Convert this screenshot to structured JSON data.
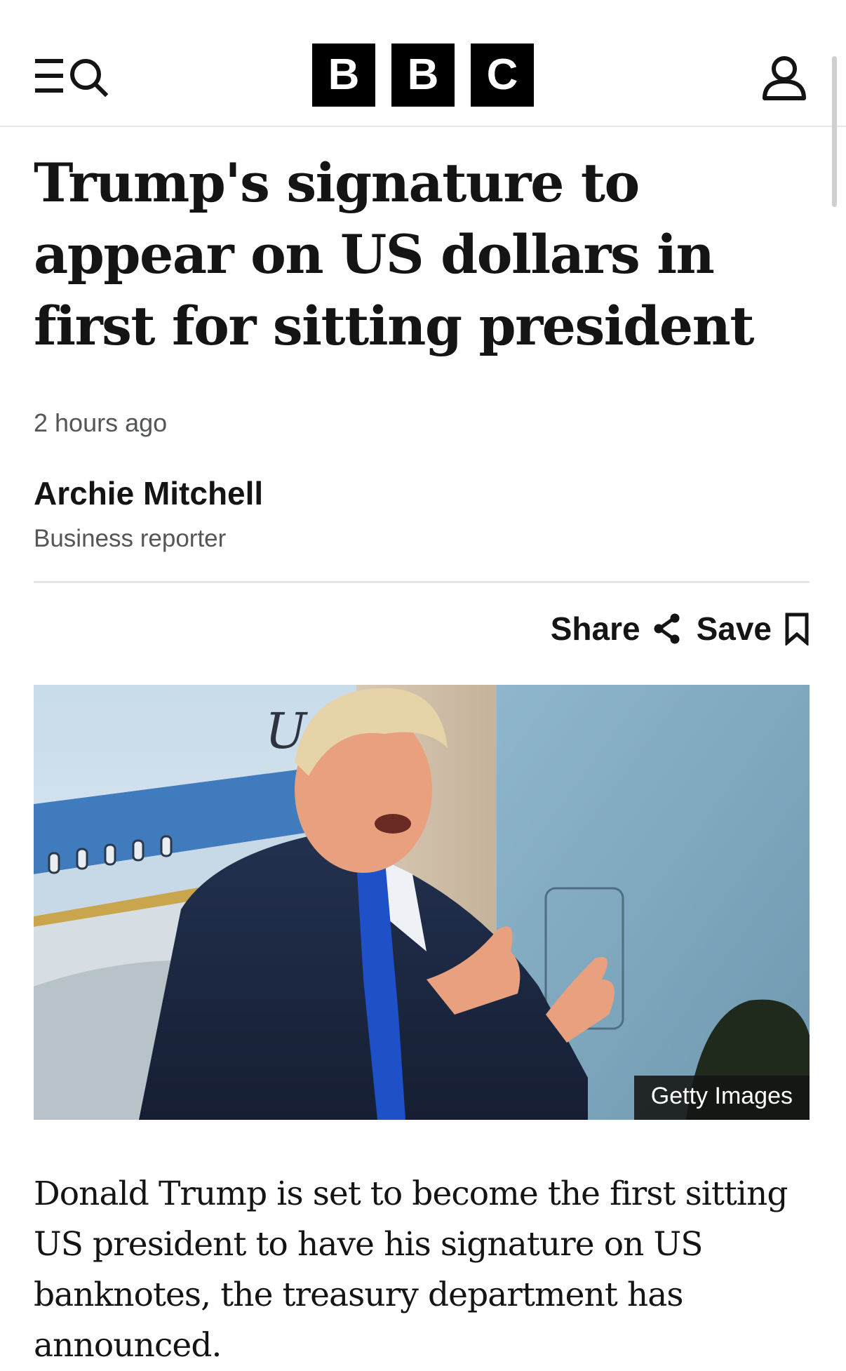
{
  "header": {
    "logo_letters": [
      "B",
      "B",
      "C"
    ],
    "menu_icon": "menu-icon",
    "search_icon": "search-icon",
    "account_icon": "account-icon"
  },
  "article": {
    "headline": "Trump's signature to appear on US dollars in first for sitting president",
    "timestamp": "2 hours ago",
    "author": "Archie Mitchell",
    "author_role": "Business reporter",
    "share_label": "Share",
    "save_label": "Save",
    "image_credit": "Getty Images",
    "lede": "Donald Trump is set to become the first sitting US president to have his signature on US banknotes, the treasury department has announced."
  },
  "colors": {
    "text": "#141414",
    "secondary_text": "#545658",
    "divider": "#e6e6e6",
    "logo_block": "#000000",
    "credit_background": "#141414"
  }
}
